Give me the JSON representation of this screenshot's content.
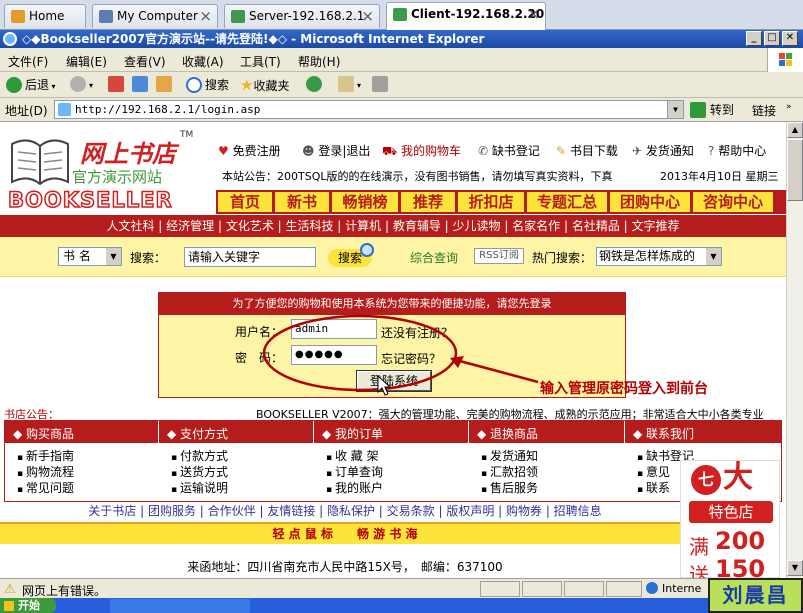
{
  "tabs": [
    {
      "label": "Home"
    },
    {
      "label": "My Computer"
    },
    {
      "label": "Server-192.168.2.1"
    },
    {
      "label": "Client-192.168.2.20"
    }
  ],
  "window": {
    "title": "◇◆Bookseller2007官方演示站--请先登陆!◆◇ - Microsoft Internet Explorer",
    "min": "_",
    "max": "□",
    "close": "✕"
  },
  "menu": [
    "文件(F)",
    "编辑(E)",
    "查看(V)",
    "收藏(A)",
    "工具(T)",
    "帮助(H)"
  ],
  "toolbar": {
    "back": "后退",
    "search": "搜索",
    "favorites": "收藏夹"
  },
  "address": {
    "label": "地址(D)",
    "url": "http://192.168.2.1/login.asp",
    "go": "转到",
    "links": "链接"
  },
  "site": {
    "logo_main": "网上书店",
    "logo_sub": "官方演示网站",
    "logo_tm": "TM",
    "logo_en": "BOOKSELLER",
    "top_links": [
      "免费注册",
      "登录|退出",
      "我的购物车",
      "缺书登记",
      "书目下载",
      "发货通知",
      "帮助中心"
    ],
    "notice": "本站公告：200TSQL版的的在线演示，没有图书销售，请勿填写真实资料，下真",
    "date": "2013年4月10日 星期三",
    "nav": [
      "首页",
      "新书",
      "畅销榜",
      "推荐",
      "折扣店",
      "专题汇总",
      "团购中心",
      "咨询中心"
    ],
    "categories": "人文社科 | 经济管理 | 文化艺术 | 生活科技 | 计算机 | 教育辅导 | 少儿读物 | 名家名作 | 名社精品 | 文字推荐",
    "search": {
      "type": "书 名",
      "label": "搜索：",
      "placeholder": "请输入关键字",
      "button": "搜索",
      "advanced": "综合查询",
      "rss": "RSS订阅",
      "hot_label": "热门搜索：",
      "hot_value": "钢铁是怎样炼成的"
    },
    "login": {
      "header": "为了方便您的购物和使用本系统为您带来的便捷功能，请您先登录",
      "user_label": "用户名：",
      "user_value": "admin",
      "register": "还没有注册？",
      "pwd_label": "密　码：",
      "pwd_value": "●●●●●",
      "forgot": "忘记密码？",
      "submit": "登陆系统"
    },
    "annotation": "输入管理原密码登入到前台",
    "store_notice_label": "书店公告：",
    "store_notice": "BOOKSELLER V2007：强大的管理功能、完美的购物流程、成熟的示范应用；非常适合大中小各类专业",
    "info_sections": [
      {
        "title": "购买商品",
        "items": [
          "新手指南",
          "购物流程",
          "常见问题"
        ]
      },
      {
        "title": "支付方式",
        "items": [
          "付款方式",
          "送货方式",
          "运输说明"
        ]
      },
      {
        "title": "我的订单",
        "items": [
          "收 藏 架",
          "订单查询",
          "我的账户"
        ]
      },
      {
        "title": "退换商品",
        "items": [
          "发货通知",
          "汇款招领",
          "售后服务"
        ]
      },
      {
        "title": "联系我们",
        "items": [
          "缺书登记",
          "意见",
          "联系"
        ]
      }
    ],
    "footer_links": "关于书店 | 团购服务 | 合作伙伴 | 友情链接 | 隐私保护 | 交易条款 | 版权声明 | 购物券 | 招聘信息",
    "slogan": "轻 点 鼠 标　　畅 游 书 海",
    "address_line": "来函地址：四川省南充市人民中路15X号，　邮编：637100",
    "ad": {
      "top": "七大",
      "mid": "特色店",
      "line1": "满",
      "num1": "200",
      "line2": "送",
      "num2": "150"
    }
  },
  "status": {
    "text": "网页上有错误。",
    "zone": "Interne"
  },
  "taskbar": {
    "start": "开始"
  },
  "watermark": "刘晨昌",
  "colors": {
    "red": "#b51d1d",
    "yellow": "#fdf4a6",
    "nav_yellow": "#fde43a",
    "annotation": "#b30000"
  }
}
